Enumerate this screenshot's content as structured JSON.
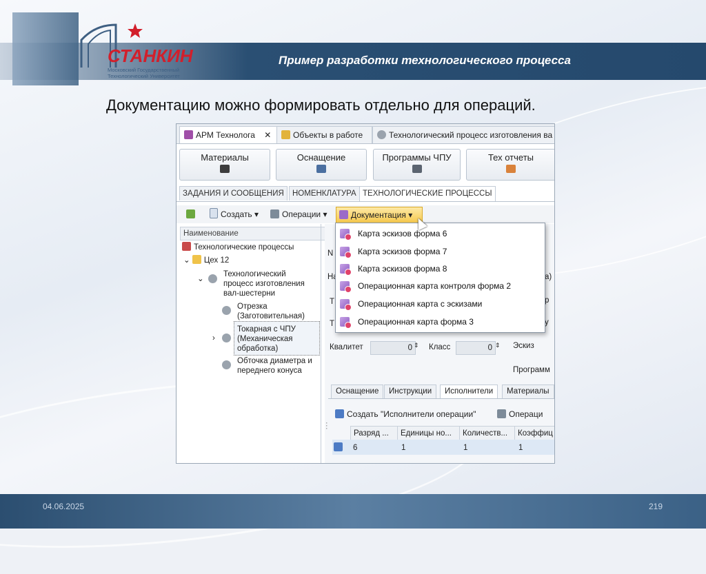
{
  "slide": {
    "title": "Пример разработки технологического процесса",
    "subtitle": "Документацию можно формировать отдельно для операций.",
    "logo_text": "СТАНКИН",
    "logo_sub1": "Московский Государственный",
    "logo_sub2": "Технологический Университет",
    "footer_date": "04.06.2025",
    "footer_page": "219"
  },
  "app": {
    "doc_tabs": [
      "АРМ Технолога",
      "Объекты в работе",
      "Технологический процесс изготовления ва"
    ],
    "big_buttons": [
      {
        "label": "Материалы",
        "icon": "materials-icon"
      },
      {
        "label": "Оснащение",
        "icon": "equipment-icon"
      },
      {
        "label": "Программы ЧПУ",
        "icon": "cnc-program-icon"
      },
      {
        "label": "Тех отчеты",
        "icon": "reports-icon"
      }
    ],
    "section_tabs": [
      "ЗАДАНИЯ И СООБЩЕНИЯ",
      "НОМЕНКЛАТУРА",
      "ТЕХНОЛОГИЧЕСКИЕ ПРОЦЕССЫ"
    ],
    "toolbar": {
      "create": "Создать",
      "operations": "Операции",
      "documentation": "Документация"
    },
    "tree": {
      "header": "Наименование",
      "root": "Технологические процессы",
      "workshop": "Цех 12",
      "process_l1": "Технологический",
      "process_l2": "процесс изготовления",
      "process_l3": "вал-шестерни",
      "op1_l1": "Отрезка",
      "op1_l2": "(Заготовительная)",
      "op2_l1": "Токарная с ЧПУ",
      "op2_l2": "(Механическая",
      "op2_l3": "обработка)",
      "op3_l1": "Обточка диаметра и",
      "op3_l2": "переднего конуса"
    },
    "form": {
      "kvalitet_label": "Квалитет",
      "kvalitet_value": "0",
      "klass_label": "Класс",
      "klass_value": "0",
      "eskiz_label": "Эскиз",
      "programma_label": "Программ",
      "partial_n": "N",
      "partial_na": "На",
      "partial_t1": "Т",
      "partial_t2": "Т",
      "partial_a": "а)",
      "partial_r": "р",
      "partial_y": "у"
    },
    "bottom_tabs": [
      "Оснащение",
      "Инструкции",
      "Исполнители",
      "Материалы"
    ],
    "bottom_toolbar": {
      "create": "Создать \"Исполнители операции\"",
      "operations": "Операци"
    },
    "grid": {
      "columns": [
        "Разряд ...",
        "Единицы но...",
        "Количеств...",
        "Коэффиц"
      ],
      "row": [
        "6",
        "1",
        "1",
        "1"
      ]
    }
  },
  "dropdown": {
    "items": [
      "Карта эскизов форма 6",
      "Карта эскизов форма 7",
      "Карта эскизов форма 8",
      "Операционная карта контроля форма 2",
      "Операционная карта с эскизами",
      "Операционная карта форма 3"
    ]
  }
}
